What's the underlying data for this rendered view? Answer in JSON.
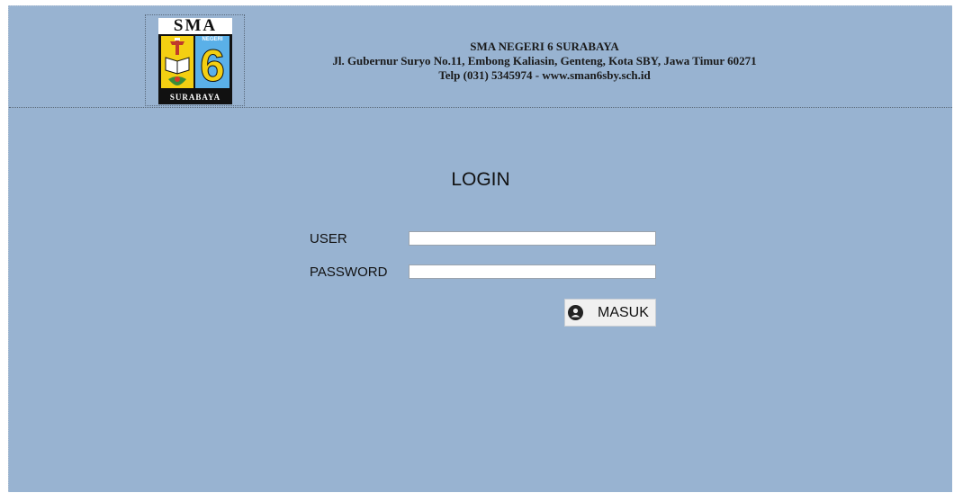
{
  "header": {
    "logo": {
      "top_text": "SMA",
      "side_text": "NEGERI",
      "number": "6",
      "bottom_text": "SURABAYA"
    },
    "school_name": "SMA NEGERI 6 SURABAYA",
    "address": "Jl. Gubernur Suryo No.11, Embong Kaliasin, Genteng, Kota SBY, Jawa Timur 60271",
    "contact": "Telp (031) 5345974 - www.sman6sby.sch.id"
  },
  "login": {
    "title": "LOGIN",
    "user_label": "USER",
    "user_value": "",
    "password_label": "PASSWORD",
    "password_value": "",
    "submit_label": "MASUK",
    "submit_icon": "user-circle-icon"
  },
  "colors": {
    "background": "#98b3d1",
    "logo_yellow": "#f3cf12",
    "logo_blue": "#5ab0e8"
  }
}
